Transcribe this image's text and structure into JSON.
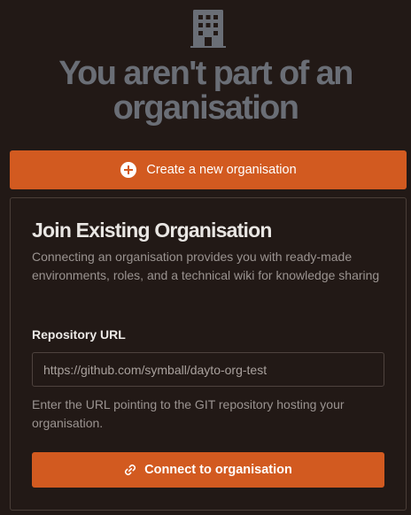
{
  "header": {
    "icon": "building-icon",
    "title": "You aren't part of an organisation"
  },
  "create_button": {
    "icon": "plus-circle-icon",
    "label": "Create a new organisation"
  },
  "join": {
    "title": "Join Existing Organisation",
    "description": "Connecting an organisation provides you with ready-made environments, roles, and a technical wiki for knowledge sharing",
    "repository_label": "Repository URL",
    "repository_value": "https://github.com/symball/dayto-org-test",
    "repository_help": "Enter the URL pointing to the GIT repository hosting your organisation.",
    "connect_icon": "link-icon",
    "connect_label": "Connect to organisation"
  },
  "colors": {
    "background": "#221916",
    "accent": "#d25a20",
    "title_muted": "#6a6e76"
  }
}
